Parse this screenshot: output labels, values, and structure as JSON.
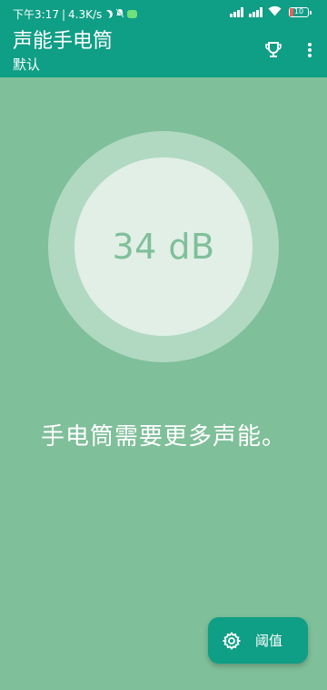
{
  "status_bar": {
    "time": "下午3:17",
    "separator": "|",
    "network_speed": "4.3K/s",
    "battery_level": "10",
    "icons": [
      "moon-icon",
      "bell-off-icon",
      "message-icon",
      "signal-icon",
      "signal-icon",
      "wifi-icon",
      "battery-icon"
    ]
  },
  "app_bar": {
    "title": "声能手电筒",
    "subtitle": "默认",
    "actions": [
      "trophy-icon",
      "more-vert-icon"
    ]
  },
  "meter": {
    "reading": "34 dB"
  },
  "message": "手电筒需要更多声能。",
  "fab": {
    "label": "阈值",
    "icon": "gear-icon"
  },
  "colors": {
    "primary": "#0f9e86",
    "background": "#7fbf9a",
    "outer_ring": "#b1d9c2",
    "inner_disc": "#e1efe7",
    "reading_text": "#7fbf9a"
  }
}
